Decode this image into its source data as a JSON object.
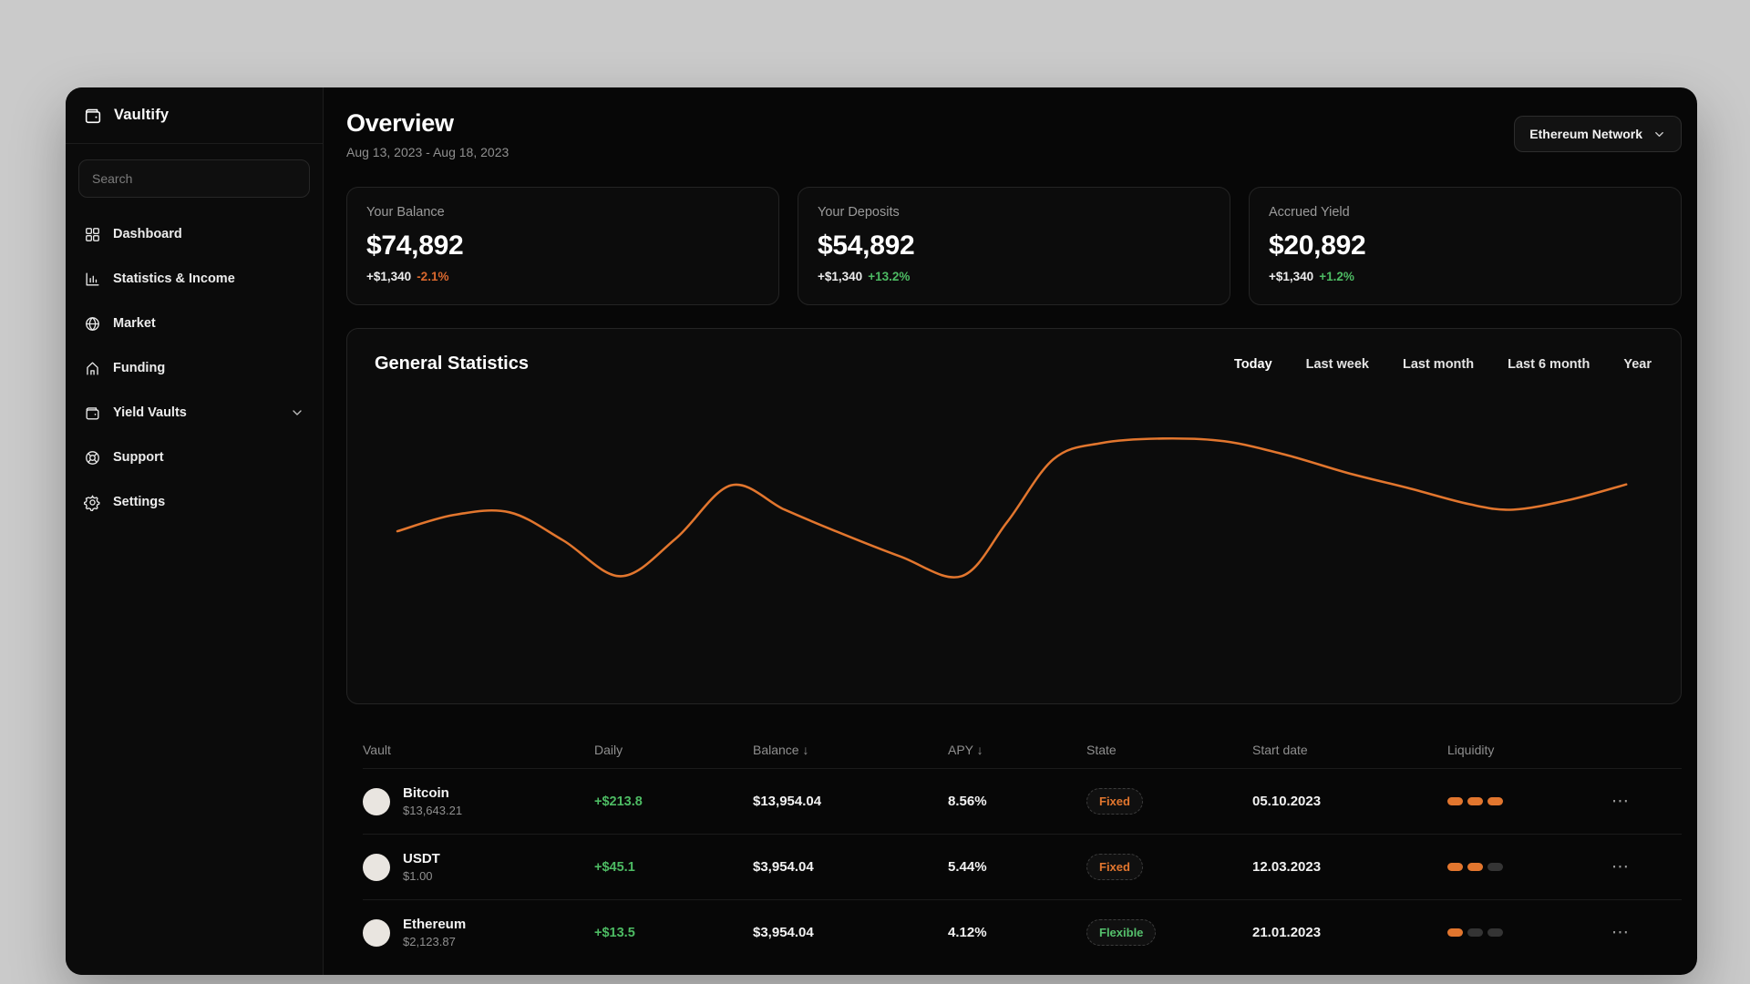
{
  "app": {
    "name": "Vaultify"
  },
  "sidebar": {
    "search_placeholder": "Search",
    "items": [
      {
        "label": "Dashboard",
        "icon": "dashboard-icon"
      },
      {
        "label": "Statistics & Income",
        "icon": "stats-icon"
      },
      {
        "label": "Market",
        "icon": "globe-icon"
      },
      {
        "label": "Funding",
        "icon": "home-icon"
      },
      {
        "label": "Yield Vaults",
        "icon": "wallet-icon",
        "chevron": true
      },
      {
        "label": "Support",
        "icon": "support-icon"
      },
      {
        "label": "Settings",
        "icon": "gear-icon"
      }
    ]
  },
  "header": {
    "title": "Overview",
    "date_range": "Aug 13, 2023 - Aug 18, 2023",
    "network": {
      "label": "Ethereum Network"
    }
  },
  "stat_cards": [
    {
      "label": "Your Balance",
      "value": "$74,892",
      "delta": "+$1,340",
      "percent": "-2.1%",
      "percent_color": "#d9682e"
    },
    {
      "label": "Your Deposits",
      "value": "$54,892",
      "delta": "+$1,340",
      "percent": "+13.2%",
      "percent_color": "#4dbb63"
    },
    {
      "label": "Accrued Yield",
      "value": "$20,892",
      "delta": "+$1,340",
      "percent": "+1.2%",
      "percent_color": "#4dbb63"
    }
  ],
  "statistics": {
    "title": "General Statistics",
    "tabs": [
      "Today",
      "Last week",
      "Last month",
      "Last 6 month",
      "Year"
    ],
    "active_tab": "Today"
  },
  "chart_data": {
    "type": "line",
    "title": "General Statistics",
    "xlabel": "",
    "ylabel": "",
    "axes": "none",
    "grid": false,
    "legend": false,
    "x_range": [
      0,
      1460
    ],
    "y_range": [
      0,
      330
    ],
    "y_is_screen_px": true,
    "series": [
      {
        "name": "portfolio-value",
        "color": "#e2762e",
        "points": [
          [
            26,
            160
          ],
          [
            90,
            142
          ],
          [
            154,
            139
          ],
          [
            215,
            170
          ],
          [
            281,
            210
          ],
          [
            344,
            168
          ],
          [
            407,
            109
          ],
          [
            468,
            136
          ],
          [
            524,
            159
          ],
          [
            600,
            188
          ],
          [
            670,
            210
          ],
          [
            722,
            150
          ],
          [
            775,
            80
          ],
          [
            830,
            62
          ],
          [
            900,
            57
          ],
          [
            970,
            60
          ],
          [
            1040,
            75
          ],
          [
            1110,
            95
          ],
          [
            1180,
            112
          ],
          [
            1250,
            130
          ],
          [
            1300,
            136
          ],
          [
            1365,
            125
          ],
          [
            1429,
            108
          ]
        ]
      }
    ]
  },
  "table": {
    "columns": [
      "Vault",
      "Daily",
      "Balance ↓",
      "APY ↓",
      "State",
      "Start date",
      "Liquidity"
    ],
    "rows": [
      {
        "name": "Bitcoin",
        "price": "$13,643.21",
        "daily": "+$213.8",
        "balance": "$13,954.04",
        "apy": "8.56%",
        "state": "Fixed",
        "state_color": "#e2762e",
        "start_date": "05.10.2023",
        "liquidity_active": 3,
        "liquidity_total": 3,
        "menu": "⋯"
      },
      {
        "name": "USDT",
        "price": "$1.00",
        "daily": "+$45.1",
        "balance": "$3,954.04",
        "apy": "5.44%",
        "state": "Fixed",
        "state_color": "#e2762e",
        "start_date": "12.03.2023",
        "liquidity_active": 2,
        "liquidity_total": 3,
        "menu": "⋯"
      },
      {
        "name": "Ethereum",
        "price": "$2,123.87",
        "daily": "+$13.5",
        "balance": "$3,954.04",
        "apy": "4.12%",
        "state": "Flexible",
        "state_color": "#55c06c",
        "start_date": "21.01.2023",
        "liquidity_active": 1,
        "liquidity_total": 3,
        "menu": "⋯"
      }
    ]
  },
  "colors": {
    "accent": "#e2762e",
    "positive": "#4dbb63",
    "negative": "#d9682e",
    "liquidity_inactive": "#343434"
  }
}
